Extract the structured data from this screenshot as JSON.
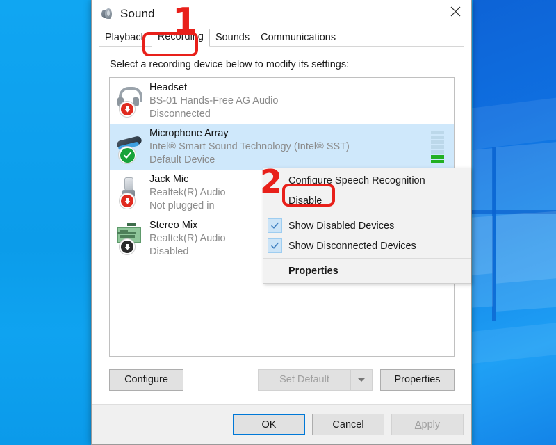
{
  "window": {
    "title": "Sound",
    "icon": "speaker-icon",
    "close_label": "✕"
  },
  "tabs": [
    {
      "label": "Playback",
      "active": false
    },
    {
      "label": "Recording",
      "active": true
    },
    {
      "label": "Sounds",
      "active": false
    },
    {
      "label": "Communications",
      "active": false
    }
  ],
  "hint": "Select a recording device below to modify its settings:",
  "devices": [
    {
      "name": "Headset",
      "driver": "BS-01 Hands-Free AG Audio",
      "status": "Disconnected",
      "icon": "headset-icon",
      "badge": "red-down-arrow-badge",
      "selected": false,
      "meter": null
    },
    {
      "name": "Microphone Array",
      "driver": "Intel® Smart Sound Technology (Intel® SST)",
      "status": "Default Device",
      "icon": "microphone-array-icon",
      "badge": "green-check-badge",
      "selected": true,
      "meter": {
        "segments": 7,
        "active": 2
      }
    },
    {
      "name": "Jack Mic",
      "driver": "Realtek(R) Audio",
      "status": "Not plugged in",
      "icon": "jack-mic-icon",
      "badge": "red-down-arrow-badge",
      "selected": false,
      "meter": null
    },
    {
      "name": "Stereo Mix",
      "driver": "Realtek(R) Audio",
      "status": "Disabled",
      "icon": "sound-card-icon",
      "badge": "black-down-arrow-badge",
      "selected": false,
      "meter": null
    }
  ],
  "action_buttons": {
    "configure": "Configure",
    "set_default": "Set Default",
    "set_default_caret": "chevron-down-icon",
    "properties": "Properties"
  },
  "footer_buttons": {
    "ok": "OK",
    "cancel": "Cancel",
    "apply": "Apply"
  },
  "context_menu": {
    "items": [
      {
        "label": "Configure Speech Recognition",
        "type": "item",
        "checked": false,
        "bold": false
      },
      {
        "label": "Disable",
        "type": "item",
        "checked": false,
        "bold": false
      },
      {
        "type": "separator"
      },
      {
        "label": "Show Disabled Devices",
        "type": "check",
        "checked": true,
        "bold": false
      },
      {
        "label": "Show Disconnected Devices",
        "type": "check",
        "checked": true,
        "bold": false
      },
      {
        "type": "separator"
      },
      {
        "label": "Properties",
        "type": "item",
        "checked": false,
        "bold": true
      }
    ]
  },
  "annotations": [
    {
      "number": "1",
      "target": "Recording tab"
    },
    {
      "number": "2",
      "target": "Disable menu item"
    }
  ],
  "colors": {
    "accent": "#0078d7",
    "annotation": "#e8201a",
    "selection": "#cfe8fb",
    "meter_active": "#22b022",
    "desktop": "#0c9ded"
  }
}
